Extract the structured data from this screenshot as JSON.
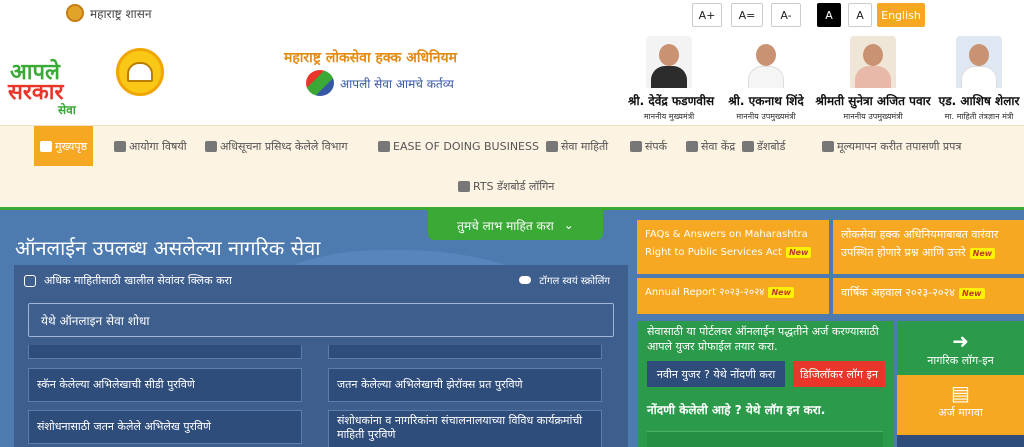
{
  "top": {
    "govt_label": "महाराष्ट्र शासन",
    "font_increase": "A+",
    "font_reset": "A=",
    "font_decrease": "A-",
    "contrast_dark": "A",
    "contrast_light": "A",
    "language": "English"
  },
  "header": {
    "logo_line1": "आपले",
    "logo_line2": "सरकार",
    "logo_line3": "सेवा",
    "act_title": "महाराष्ट्र लोकसेवा हक्क अधिनियम",
    "tagline": "आपली सेवा आमचे कर्तव्य",
    "leaders": [
      {
        "name": "श्री. देवेंद्र फडणवीस",
        "role": "माननीय मुख्यमंत्री",
        "color": "#f3f3f3"
      },
      {
        "name": "श्री. एकनाथ शिंदे",
        "role": "माननीय उपमुख्यमंत्री",
        "color": "#ffffff"
      },
      {
        "name": "श्रीमती सुनेत्रा अजित पवार",
        "role": "माननीय उपमुख्यमंत्री",
        "color": "#f0e6d8"
      },
      {
        "name": "एड. आशिष शेलार",
        "role": "मा. माहिती तंत्रज्ञान मंत्री",
        "color": "#dfe8f2"
      }
    ]
  },
  "nav": {
    "items": [
      {
        "label": "मुख्यपृष्ठ",
        "icon": "home-icon"
      },
      {
        "label": "आयोगा विषयी",
        "icon": "person-icon"
      },
      {
        "label": "अधिसूचना प्रसिध्द केलेले विभाग",
        "icon": "users-icon"
      },
      {
        "label": "EASE OF DOING BUSINESS",
        "icon": "briefcase-icon"
      },
      {
        "label": "सेवा माहिती",
        "icon": "briefcase-icon"
      },
      {
        "label": "संपर्क",
        "icon": "phone-icon"
      },
      {
        "label": "सेवा केंद्र",
        "icon": "user-icon"
      },
      {
        "label": "डॅशबोर्ड",
        "icon": "dashboard-icon"
      },
      {
        "label": "मूल्यमापन करीत तपासणी प्रपत्र",
        "icon": "briefcase-icon"
      },
      {
        "label": "RTS डॅशबोर्ड लॉगिन",
        "icon": "login-icon"
      }
    ]
  },
  "main": {
    "benefit_toggle": "तुमचे लाभ माहित करा",
    "services_title": "ऑनलाईन उपलब्ध असलेल्या नागरिक सेवा",
    "panel_hint": "अधिक माहितीसाठी खालील सेवांवर क्लिक करा",
    "toggle_scroll": "टॉगल स्वयं स्क्रोलिंग",
    "search_placeholder": "येथे ऑनलाइन सेवा शोधा",
    "services": [
      "स्कॅन केलेल्या अभिलेखाची सीडी पुरविणे",
      "जतन केलेल्या अभिलेखाची झेरॉक्स प्रत पुरविणे",
      "संशोधनासाठी जतन केलेले अभिलेख पुरविणे",
      "संशोधकांना व नागरिकांना संचालनालयाच्या विविध कार्यक्रमांची माहिती पुरविणे"
    ]
  },
  "right": {
    "faq": "FAQs & Answers on Maharashtra Right to Public Services Act",
    "faq_marathi": "लोकसेवा हक्क अधिनियमाबाबत वारंवार उपस्थित होणारे प्रश्न आणि उत्तरे",
    "annual_report": "Annual Report २०२३-२०२४",
    "annual_report_marathi": "वार्षिक अहवाल २०२३-२०२४",
    "new_badge": "New",
    "register_text": "सेवासाठी या पोर्टलवर ऑनलाईन पद्धतीने अर्ज करण्यासाठी आपले युजर प्रोफाईल तयार करा.",
    "new_user": "नवीन युजर ? येथे नोंदणी करा",
    "digilocker": "डिजिलॉकर लॉग इन",
    "registered": "नोंदणी केलेली आहे ? येथे लॉग इन करा.",
    "citizen_login": "नागरिक लॉग-इन",
    "apply": "अर्ज मागवा"
  }
}
